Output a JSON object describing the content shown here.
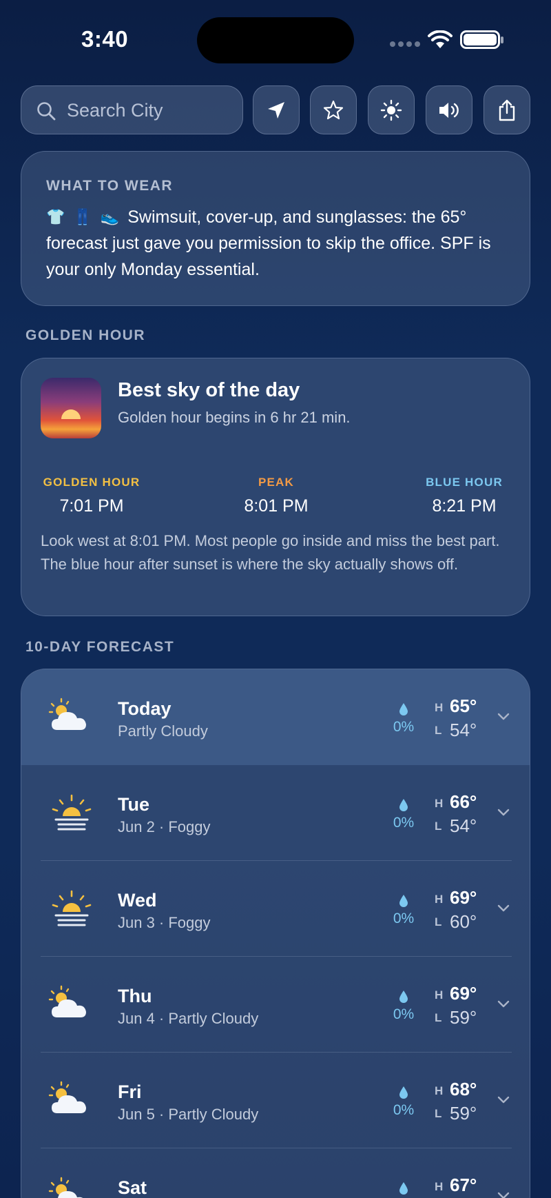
{
  "status_bar": {
    "time": "3:40"
  },
  "search": {
    "placeholder": "Search City"
  },
  "toolbar": {
    "buttons": [
      "location-arrow-icon",
      "star-icon",
      "brightness-icon",
      "speaker-icon",
      "share-icon"
    ]
  },
  "wear": {
    "label": "WHAT TO WEAR",
    "icons": [
      "👕",
      "👖",
      "👟"
    ],
    "text": "Swimsuit, cover-up, and sunglasses: the 65° forecast just gave you permission to skip the office. SPF is your only Monday essential."
  },
  "golden": {
    "section_title": "GOLDEN HOUR",
    "title": "Best sky of the day",
    "subtitle": "Golden hour begins in 6 hr 21 min.",
    "golden_label": "GOLDEN HOUR",
    "golden_time": "7:01 PM",
    "peak_label": "PEAK",
    "peak_time": "8:01 PM",
    "blue_label": "BLUE HOUR",
    "blue_time": "8:21 PM",
    "note": "Look west at 8:01 PM. Most people go inside and miss the best part. The blue hour after sunset is where the sky actually shows off.",
    "colors": {
      "golden": "#f3c043",
      "peak": "#f39a45",
      "blue": "#7cc8f0"
    }
  },
  "forecast": {
    "section_title": "10-DAY FORECAST",
    "high_tag": "H",
    "low_tag": "L",
    "days": [
      {
        "name": "Today",
        "desc": "Partly Cloudy",
        "icon": "partly-cloudy-icon",
        "precip": "0%",
        "high": "65°",
        "low": "54°"
      },
      {
        "name": "Tue",
        "desc": "Jun 2 · Foggy",
        "icon": "foggy-sun-icon",
        "precip": "0%",
        "high": "66°",
        "low": "54°"
      },
      {
        "name": "Wed",
        "desc": "Jun 3 · Foggy",
        "icon": "foggy-sun-icon",
        "precip": "0%",
        "high": "69°",
        "low": "60°"
      },
      {
        "name": "Thu",
        "desc": "Jun 4 · Partly Cloudy",
        "icon": "partly-cloudy-icon",
        "precip": "0%",
        "high": "69°",
        "low": "59°"
      },
      {
        "name": "Fri",
        "desc": "Jun 5 · Partly Cloudy",
        "icon": "partly-cloudy-icon",
        "precip": "0%",
        "high": "68°",
        "low": "59°"
      },
      {
        "name": "Sat",
        "desc": "",
        "icon": "partly-cloudy-icon",
        "precip": "",
        "high": "67°",
        "low": ""
      }
    ]
  }
}
